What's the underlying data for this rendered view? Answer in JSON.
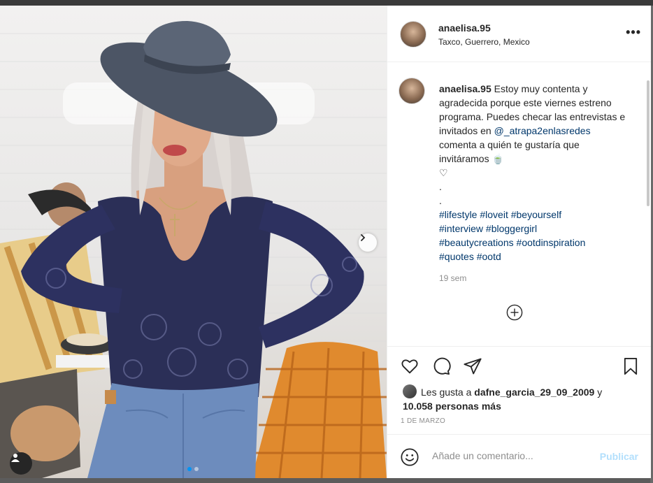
{
  "post": {
    "username": "anaelisa.95",
    "location": "Taxco, Guerrero, Mexico",
    "more_icon": "more-horizontal-icon"
  },
  "caption": {
    "username": "anaelisa.95",
    "text_1": "Estoy muy contenta y agradecida porque este viernes estreno programa. Puedes checar las entrevistas e invitados en",
    "mention": "@_atrapa2enlasredes",
    "text_2": "comenta a quién te gustaría que invitáramos",
    "emoji": "🍵",
    "heart": "♡",
    "dot_1": ".",
    "dot_2": ".",
    "hashtags": [
      "#lifestyle",
      "#loveit",
      "#beyourself",
      "#interview",
      "#bloggergirl",
      "#beautycreations",
      "#ootdinspiration",
      "#quotes",
      "#ootd"
    ],
    "time_ago": "19 sem"
  },
  "likes": {
    "prefix": "Les gusta a",
    "user": "dafne_garcia_29_09_2009",
    "joiner": "y",
    "others": "10.058 personas más"
  },
  "date": "1 DE MARZO",
  "comment": {
    "placeholder": "Añade un comentario...",
    "publish": "Publicar"
  },
  "carousel": {
    "slides": 2,
    "active": 1
  },
  "colors": {
    "accent": "#0095f6",
    "link": "#00376b",
    "publish_disabled": "#b2dffc",
    "muted": "#8e8e8e"
  }
}
